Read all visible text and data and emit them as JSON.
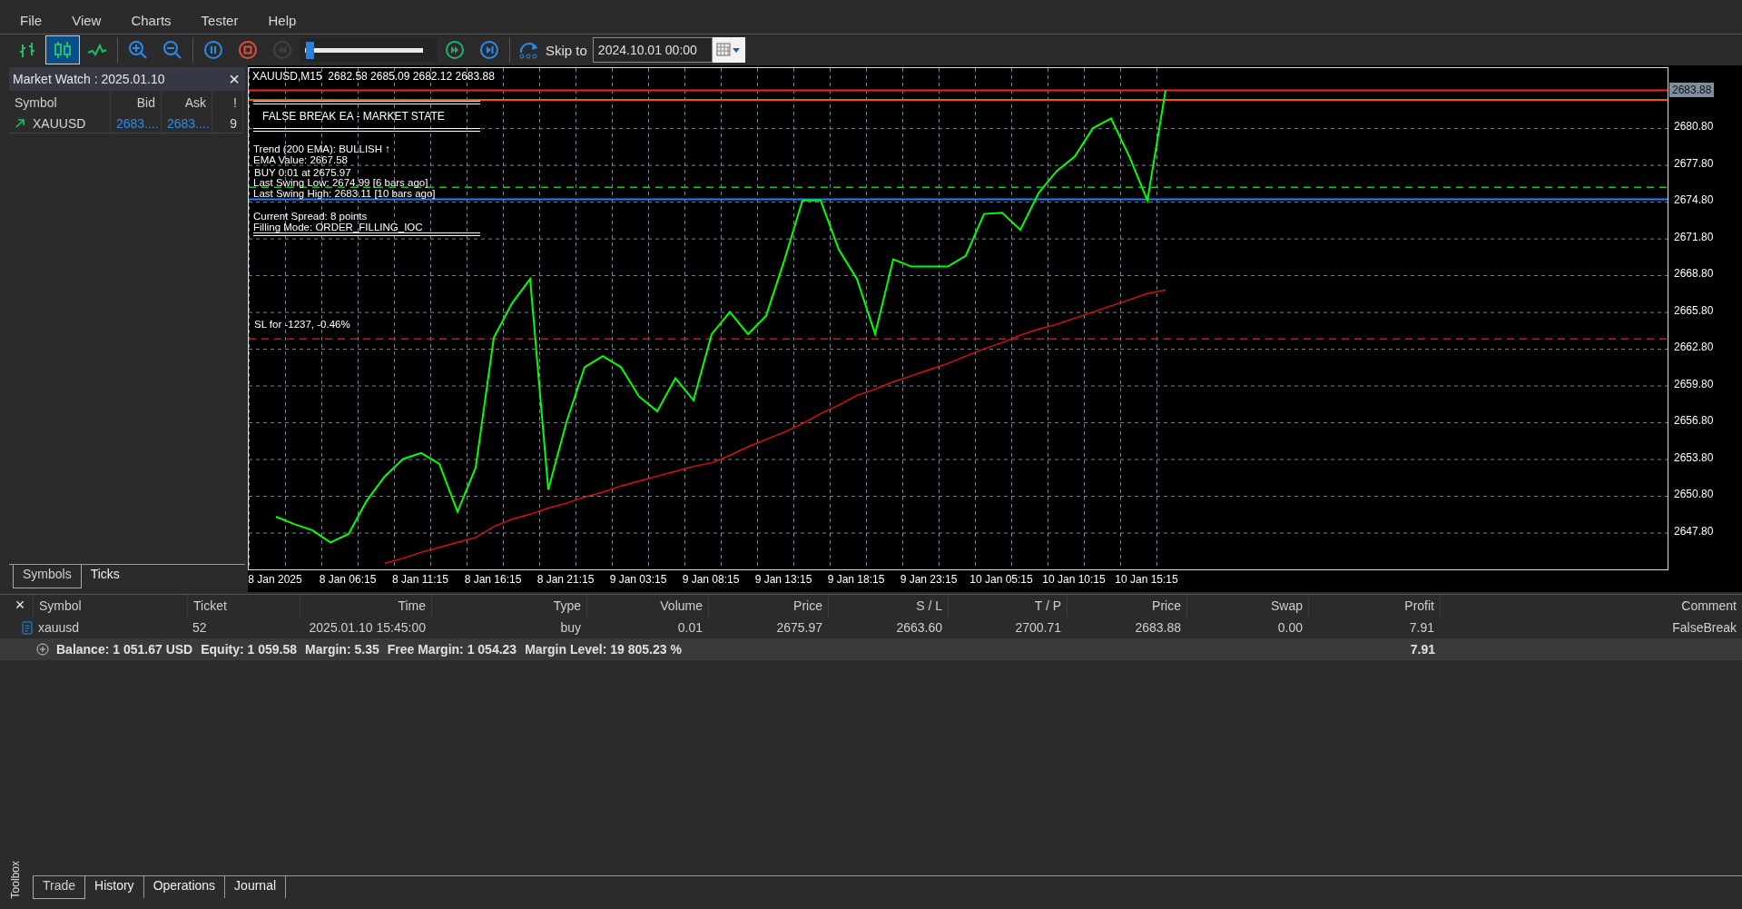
{
  "menu": [
    "File",
    "View",
    "Charts",
    "Tester",
    "Help"
  ],
  "toolbar": {
    "chart_types": [
      {
        "kind": "bars",
        "selected": false
      },
      {
        "kind": "candles",
        "selected": true
      },
      {
        "kind": "line",
        "selected": false
      }
    ],
    "zoom": [
      {
        "kind": "zoom_in"
      },
      {
        "kind": "zoom_out"
      }
    ],
    "playback": [
      {
        "kind": "pause",
        "disabled": false
      },
      {
        "kind": "stop",
        "disabled": false
      },
      {
        "kind": "rewind",
        "disabled": true
      }
    ],
    "speed": {
      "level": 0.02
    },
    "playback_after": [
      {
        "kind": "fast_forward",
        "disabled": false
      },
      {
        "kind": "skip_end",
        "disabled": false
      }
    ],
    "skip_to": {
      "label": "Skip to",
      "value": "2024.10.01 00:00"
    }
  },
  "market_watch": {
    "title": "Market Watch : 2025.01.10",
    "close": "×",
    "columns": [
      "Symbol",
      "Bid",
      "Ask",
      "!"
    ],
    "rows": [
      {
        "symbol": "XAUUSD",
        "bid": "2683....",
        "ask": "2683....",
        "spread": "9"
      }
    ],
    "tabs": [
      {
        "label": "Symbols",
        "selected": true
      },
      {
        "label": "Ticks",
        "selected": false
      }
    ]
  },
  "chart": {
    "title": "XAUUSD,M15  2682.58 2685.09 2682.12 2683.88",
    "price_label": "2683.88",
    "panel": {
      "title": "FALSE BREAK EA - MARKET STATE",
      "groups": [
        [
          "Trend (200 EMA): BULLISH ↑",
          "EMA Value: 2667.58"
        ],
        [
          "Last Swing Low: 2674.99 [6 bars ago]",
          "Last Swing High: 2683.11 [10 bars ago]"
        ],
        [
          "Current Spread: 8 points",
          "Filling Mode: ORDER_FILLING_IOC"
        ]
      ]
    },
    "chart_data": {
      "type": "line",
      "categories": [
        "8 Jan 2025",
        null,
        null,
        null,
        "8 Jan 06:15",
        null,
        null,
        null,
        "8 Jan 11:15",
        null,
        null,
        null,
        "8 Jan 16:15",
        null,
        null,
        null,
        "8 Jan 21:15",
        null,
        null,
        null,
        "9 Jan 03:15",
        null,
        null,
        null,
        "9 Jan 08:15",
        null,
        null,
        null,
        "9 Jan 13:15",
        null,
        null,
        null,
        "9 Jan 18:15",
        null,
        null,
        null,
        "9 Jan 23:15",
        null,
        null,
        null,
        "10 Jan 05:15",
        null,
        null,
        null,
        "10 Jan 10:15",
        null,
        null,
        null,
        "10 Jan 15:15",
        null
      ],
      "series": [
        {
          "color": "#00ff00",
          "values": [
            2649.1,
            2648.5,
            2648.0,
            2647.0,
            2647.7,
            2650.4,
            2652.4,
            2653.8,
            2654.3,
            2653.4,
            2649.5,
            2653.1,
            2663.7,
            2666.5,
            2668.5,
            2651.3,
            2656.8,
            2661.3,
            2662.2,
            2661.3,
            2658.9,
            2657.7,
            2660.4,
            2658.6,
            2664.0,
            2665.8,
            2664.0,
            2665.5,
            2670.0,
            2674.9,
            2674.9,
            2670.9,
            2668.5,
            2664.0,
            2670.1,
            2669.5,
            2669.5,
            2669.5,
            2670.4,
            2673.8,
            2673.9,
            2672.5,
            2675.5,
            2677.3,
            2678.5,
            2680.8,
            2681.6,
            2678.5,
            2674.9,
            2683.9
          ]
        },
        {
          "color": "#e01010",
          "values": [
            null,
            null,
            null,
            null,
            null,
            null,
            2645.3,
            2645.7,
            2646.2,
            2646.6,
            2647.0,
            2647.4,
            2648.3,
            2648.9,
            2649.3,
            2649.8,
            2650.2,
            2650.7,
            2651.1,
            2651.6,
            2652.0,
            2652.4,
            2652.8,
            2653.2,
            2653.5,
            2654.1,
            2654.8,
            2655.4,
            2656.0,
            2656.7,
            2657.5,
            2658.2,
            2659.0,
            2659.5,
            2660.1,
            2660.6,
            2661.1,
            2661.6,
            2662.2,
            2662.8,
            2663.3,
            2663.9,
            2664.4,
            2664.8,
            2665.3,
            2665.8,
            2666.3,
            2666.8,
            2667.3,
            2667.6
          ]
        }
      ],
      "ylim": [
        2644.8,
        2685.7
      ],
      "grid": true,
      "yticks": [
        {
          "value": 2647.8,
          "label": "2647.80"
        },
        {
          "value": 2650.8,
          "label": "2650.80"
        },
        {
          "value": 2653.8,
          "label": "2653.80"
        },
        {
          "value": 2656.8,
          "label": "2656.80"
        },
        {
          "value": 2659.8,
          "label": "2659.80"
        },
        {
          "value": 2662.8,
          "label": "2662.80"
        },
        {
          "value": 2665.8,
          "label": "2665.80"
        },
        {
          "value": 2668.8,
          "label": "2668.80"
        },
        {
          "value": 2671.8,
          "label": "2671.80"
        },
        {
          "value": 2674.8,
          "label": "2674.80"
        },
        {
          "value": 2677.8,
          "label": "2677.80"
        },
        {
          "value": 2680.8,
          "label": "2680.80"
        }
      ],
      "ref_lines": [
        {
          "axis": "y",
          "value": 2683.88,
          "color": "#ff2020"
        },
        {
          "axis": "y",
          "value": 2683.11,
          "color": "#ff5010"
        },
        {
          "axis": "y",
          "value": 2675.97,
          "color": "#20c020",
          "label": "BUY 0.01 at 2675.97"
        },
        {
          "axis": "y",
          "value": 2674.99,
          "color": "#2080ff"
        },
        {
          "axis": "y",
          "value": 2663.6,
          "color": "#e01010",
          "label": "SL for -1237, -0.46%"
        }
      ]
    }
  },
  "trade": {
    "close": "×",
    "columns": [
      "Symbol",
      "Ticket",
      "Time",
      "Type",
      "Volume",
      "Price",
      "S / L",
      "T / P",
      "Price",
      "Swap",
      "Profit",
      "Comment"
    ],
    "rows": [
      {
        "cells": [
          "xauusd",
          "52",
          "2025.01.10 15:45:00",
          "buy",
          "0.01",
          "2675.97",
          "2663.60",
          "2700.71",
          "2683.88",
          "0.00",
          "7.91",
          "FalseBreak"
        ]
      }
    ],
    "summary": {
      "items": [
        "Balance: 1 051.67 USD",
        "Equity: 1 059.58",
        "Margin: 5.35",
        "Free Margin: 1 054.23",
        "Margin Level: 19 805.23 %"
      ],
      "profit": "7.91"
    },
    "tabs": [
      {
        "label": "Trade",
        "selected": true
      },
      {
        "label": "History",
        "selected": false
      },
      {
        "label": "Operations",
        "selected": false
      },
      {
        "label": "Journal",
        "selected": false
      }
    ],
    "side_label": "Toolbox"
  }
}
